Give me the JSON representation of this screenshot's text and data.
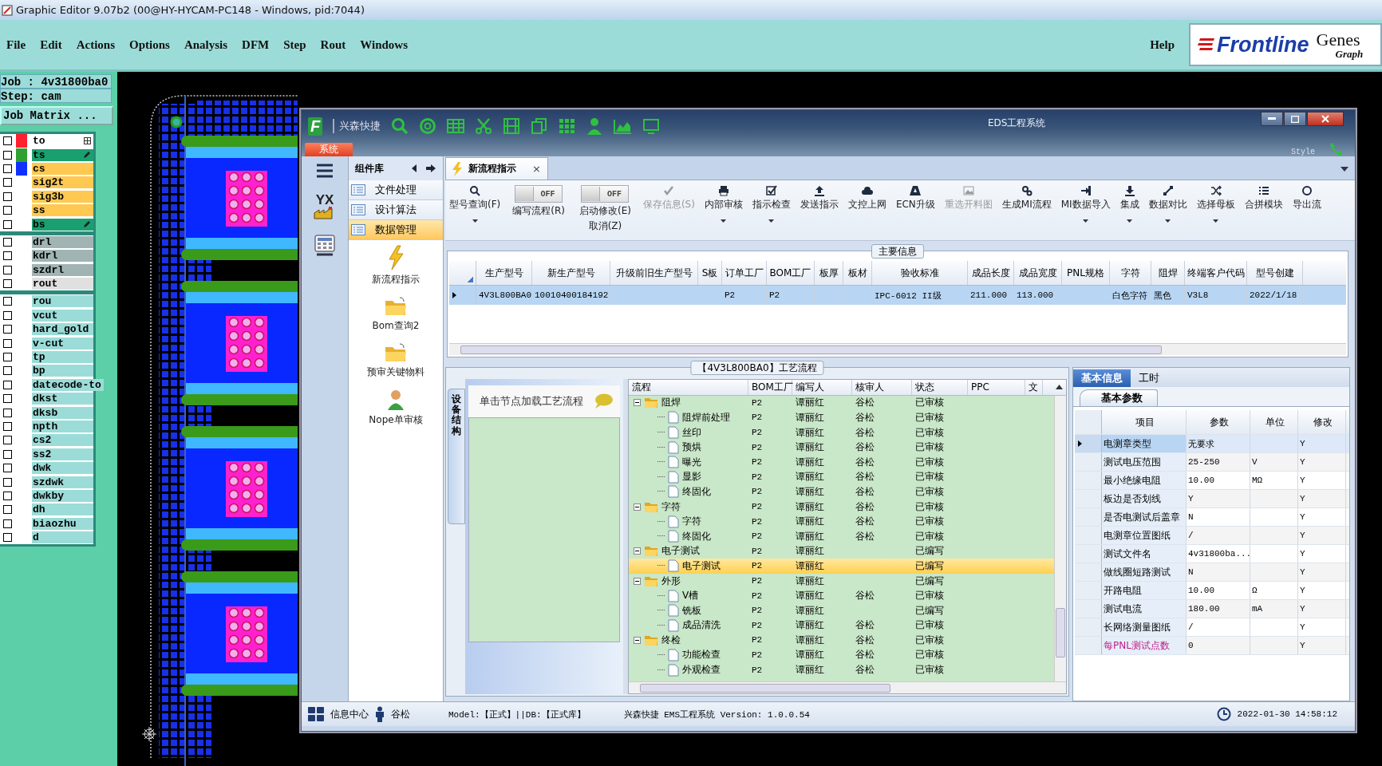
{
  "app_window": {
    "title": "Graphic Editor 9.07b2 (00@HY-HYCAM-PC148 - Windows, pid:7044)"
  },
  "menu": [
    "File",
    "Edit",
    "Actions",
    "Options",
    "Analysis",
    "DFM",
    "Step",
    "Rout",
    "Windows"
  ],
  "help": "Help",
  "logo": {
    "name": "Frontline",
    "product": "Genes",
    "subtitle": "Graph"
  },
  "job": {
    "job_label": "Job : 4v31800ba0",
    "step_label": "Step: cam",
    "matrix_button": "Job Matrix ..."
  },
  "layer_groups": [
    {
      "layers": [
        {
          "name": "to",
          "kind": "silk",
          "color": "#ff2030",
          "checked": false,
          "work_layer": true,
          "editable": false
        },
        {
          "name": "ts",
          "kind": "mask",
          "color": "#30a030",
          "checked": false,
          "work_layer": false,
          "editable": true
        },
        {
          "name": "cs",
          "kind": "signal",
          "color": "#1030ff",
          "checked": false,
          "work_layer": false,
          "editable": false
        },
        {
          "name": "sig2t",
          "kind": "signal",
          "checked": false,
          "work_layer": false,
          "editable": false
        },
        {
          "name": "sig3b",
          "kind": "signal",
          "checked": false,
          "work_layer": false,
          "editable": false
        },
        {
          "name": "ss",
          "kind": "signal",
          "checked": false,
          "work_layer": false,
          "editable": false
        },
        {
          "name": "bs",
          "kind": "mask",
          "checked": false,
          "work_layer": false,
          "editable": true
        }
      ]
    },
    {
      "layers": [
        {
          "name": "drl",
          "kind": "drill",
          "checked": false,
          "work_layer": false,
          "editable": false
        },
        {
          "name": "kdrl",
          "kind": "drill",
          "checked": false,
          "work_layer": false,
          "editable": false
        },
        {
          "name": "szdrl",
          "kind": "drill",
          "checked": false,
          "work_layer": false,
          "editable": false
        },
        {
          "name": "rout",
          "kind": "rout",
          "checked": false,
          "work_layer": false,
          "editable": false
        }
      ]
    },
    {
      "layers": [
        {
          "name": "rou",
          "kind": "misc",
          "checked": false,
          "work_layer": false,
          "editable": false
        },
        {
          "name": "vcut",
          "kind": "misc",
          "checked": false,
          "work_layer": false,
          "editable": false
        },
        {
          "name": "hard_gold",
          "kind": "misc",
          "checked": false,
          "work_layer": false,
          "editable": false
        },
        {
          "name": "v-cut",
          "kind": "misc",
          "checked": false,
          "work_layer": false,
          "editable": false
        },
        {
          "name": "tp",
          "kind": "misc",
          "checked": false,
          "work_layer": false,
          "editable": false
        },
        {
          "name": "bp",
          "kind": "misc",
          "checked": false,
          "work_layer": false,
          "editable": false
        },
        {
          "name": "datecode-to",
          "kind": "misc",
          "checked": false,
          "work_layer": false,
          "editable": false
        },
        {
          "name": "dkst",
          "kind": "misc",
          "checked": false,
          "work_layer": false,
          "editable": false
        },
        {
          "name": "dksb",
          "kind": "misc",
          "checked": false,
          "work_layer": false,
          "editable": false
        },
        {
          "name": "npth",
          "kind": "misc",
          "checked": false,
          "work_layer": false,
          "editable": false
        },
        {
          "name": "cs2",
          "kind": "misc",
          "checked": false,
          "work_layer": false,
          "editable": false
        },
        {
          "name": "ss2",
          "kind": "misc",
          "checked": false,
          "work_layer": false,
          "editable": false
        },
        {
          "name": "dwk",
          "kind": "misc",
          "checked": false,
          "work_layer": false,
          "editable": false
        },
        {
          "name": "szdwk",
          "kind": "misc",
          "checked": false,
          "work_layer": false,
          "editable": false
        },
        {
          "name": "dwkby",
          "kind": "misc",
          "checked": false,
          "work_layer": false,
          "editable": false
        },
        {
          "name": "dh",
          "kind": "misc",
          "checked": false,
          "work_layer": false,
          "editable": false
        },
        {
          "name": "biaozhu",
          "kind": "misc",
          "checked": false,
          "work_layer": false,
          "editable": false
        },
        {
          "name": "d",
          "kind": "misc",
          "checked": false,
          "work_layer": false,
          "editable": false
        }
      ]
    }
  ],
  "eds": {
    "app_letter": "F",
    "title": "EDS工程系统",
    "brand": "兴森快捷",
    "system_tab": "系统",
    "style_label": "Style",
    "nav_logo": "YX"
  },
  "component_panel": {
    "title": "组件库",
    "categories": [
      {
        "label": "文件处理",
        "selected": false
      },
      {
        "label": "设计算法",
        "selected": false
      },
      {
        "label": "数据管理",
        "selected": true
      }
    ],
    "tools": [
      "新流程指示",
      "Bom查询2",
      "预审关键物料",
      "Nope单审核"
    ]
  },
  "doc_tab": {
    "label": "新流程指示",
    "close": "×"
  },
  "ribbon": [
    {
      "kind": "button",
      "label": "型号查询(F)",
      "dropdown": true,
      "disabled": false
    },
    {
      "kind": "toggle",
      "label": "编写流程(R)",
      "state_text": "OFF",
      "on": false
    },
    {
      "kind": "toggle",
      "label": "启动修改(E)",
      "label2": "取消(Z)",
      "state_text": "OFF",
      "on": false
    },
    {
      "kind": "button",
      "label": "保存信息(S)",
      "dropdown": false,
      "disabled": true
    },
    {
      "kind": "button",
      "label": "内部审核",
      "dropdown": true,
      "disabled": false
    },
    {
      "kind": "button",
      "label": "指示检查",
      "dropdown": true,
      "disabled": false
    },
    {
      "kind": "button",
      "label": "发送指示",
      "dropdown": false,
      "disabled": false
    },
    {
      "kind": "button",
      "label": "文控上网",
      "dropdown": false,
      "disabled": false
    },
    {
      "kind": "button",
      "label": "ECN升级",
      "dropdown": false,
      "disabled": false
    },
    {
      "kind": "button",
      "label": "重选开料图",
      "dropdown": false,
      "disabled": true
    },
    {
      "kind": "button",
      "label": "生成MI流程",
      "dropdown": false,
      "disabled": false
    },
    {
      "kind": "button",
      "label": "MI数据导入",
      "dropdown": true,
      "disabled": false
    },
    {
      "kind": "button",
      "label": "集成",
      "dropdown": true,
      "disabled": false
    },
    {
      "kind": "button",
      "label": "数据对比",
      "dropdown": true,
      "disabled": false
    },
    {
      "kind": "button",
      "label": "选择母板",
      "dropdown": true,
      "disabled": false
    },
    {
      "kind": "button",
      "label": "合拼模块",
      "dropdown": false,
      "disabled": false
    },
    {
      "kind": "button",
      "label": "导出流",
      "dropdown": false,
      "disabled": false
    }
  ],
  "main_info": {
    "title": "主要信息",
    "columns": [
      "生产型号",
      "新生产型号",
      "升级前旧生产型号",
      "S板",
      "订单工厂",
      "BOM工厂",
      "板厚",
      "板材",
      "验收标准",
      "成品长度",
      "成品宽度",
      "PNL规格",
      "字符",
      "阻焊",
      "终端客户代码",
      "型号创建"
    ],
    "rows": [
      {
        "selected": true,
        "cells": [
          "4V3L800BA0",
          "10010400184192",
          "",
          "",
          "P2",
          "P2",
          "",
          "",
          "IPC-6012 II级",
          "211.000",
          "113.000",
          "",
          "白色字符",
          "黑色",
          "V3L8",
          "2022/1/18"
        ]
      }
    ]
  },
  "process": {
    "title": "【4V3L800BA0】工艺流程",
    "side_tab": "设备结构",
    "hint": "单击节点加载工艺流程",
    "columns": [
      "流程",
      "BOM工厂",
      "编写人",
      "核审人",
      "状态",
      "PPC",
      "文"
    ],
    "tree": [
      {
        "name": "阻焊",
        "factory": "P2",
        "writer": "谭丽红",
        "reviewer": "谷松",
        "status": "已审核",
        "expanded": true,
        "selected": false,
        "children": [
          {
            "name": "阻焊前处理",
            "factory": "P2",
            "writer": "谭丽红",
            "reviewer": "谷松",
            "status": "已审核",
            "selected": false
          },
          {
            "name": "丝印",
            "factory": "P2",
            "writer": "谭丽红",
            "reviewer": "谷松",
            "status": "已审核",
            "selected": false
          },
          {
            "name": "预烘",
            "factory": "P2",
            "writer": "谭丽红",
            "reviewer": "谷松",
            "status": "已审核",
            "selected": false
          },
          {
            "name": "曝光",
            "factory": "P2",
            "writer": "谭丽红",
            "reviewer": "谷松",
            "status": "已审核",
            "selected": false
          },
          {
            "name": "显影",
            "factory": "P2",
            "writer": "谭丽红",
            "reviewer": "谷松",
            "status": "已审核",
            "selected": false
          },
          {
            "name": "终固化",
            "factory": "P2",
            "writer": "谭丽红",
            "reviewer": "谷松",
            "status": "已审核",
            "selected": false
          }
        ]
      },
      {
        "name": "字符",
        "factory": "P2",
        "writer": "谭丽红",
        "reviewer": "谷松",
        "status": "已审核",
        "expanded": true,
        "selected": false,
        "children": [
          {
            "name": "字符",
            "factory": "P2",
            "writer": "谭丽红",
            "reviewer": "谷松",
            "status": "已审核",
            "selected": false
          },
          {
            "name": "终固化",
            "factory": "P2",
            "writer": "谭丽红",
            "reviewer": "谷松",
            "status": "已审核",
            "selected": false
          }
        ]
      },
      {
        "name": "电子测试",
        "factory": "P2",
        "writer": "谭丽红",
        "status": "已编写",
        "expanded": true,
        "selected": false,
        "children": [
          {
            "name": "电子测试",
            "factory": "P2",
            "writer": "谭丽红",
            "status": "已编写",
            "selected": true
          }
        ]
      },
      {
        "name": "外形",
        "factory": "P2",
        "writer": "谭丽红",
        "status": "已编写",
        "expanded": true,
        "selected": false,
        "children": [
          {
            "name": "V槽",
            "factory": "P2",
            "writer": "谭丽红",
            "reviewer": "谷松",
            "status": "已审核",
            "selected": false
          },
          {
            "name": "铣板",
            "factory": "P2",
            "writer": "谭丽红",
            "status": "已编写",
            "selected": false
          },
          {
            "name": "成品清洗",
            "factory": "P2",
            "writer": "谭丽红",
            "reviewer": "谷松",
            "status": "已审核",
            "selected": false
          }
        ]
      },
      {
        "name": "终检",
        "factory": "P2",
        "writer": "谭丽红",
        "reviewer": "谷松",
        "status": "已审核",
        "expanded": true,
        "selected": false,
        "children": [
          {
            "name": "功能检查",
            "factory": "P2",
            "writer": "谭丽红",
            "reviewer": "谷松",
            "status": "已审核",
            "selected": false
          },
          {
            "name": "外观检查",
            "factory": "P2",
            "writer": "谭丽红",
            "reviewer": "谷松",
            "status": "已审核",
            "selected": false
          }
        ]
      }
    ]
  },
  "params": {
    "tabs": [
      {
        "label": "基本信息",
        "selected": true
      },
      {
        "label": "工时",
        "selected": false
      }
    ],
    "subtab": "基本参数",
    "columns": [
      "项目",
      "参数",
      "单位",
      "修改"
    ],
    "rows": [
      {
        "item": "电测章类型",
        "value": "无要求",
        "unit": "",
        "modify": "Y",
        "selected": true,
        "highlight": false
      },
      {
        "item": "测试电压范围",
        "value": "25-250",
        "unit": "V",
        "modify": "Y",
        "selected": false,
        "highlight": false
      },
      {
        "item": "最小绝缘电阻",
        "value": "10.00",
        "unit": "MΩ",
        "modify": "Y",
        "selected": false,
        "highlight": false
      },
      {
        "item": "板边是否划线",
        "value": "Y",
        "unit": "",
        "modify": "Y",
        "selected": false,
        "highlight": false
      },
      {
        "item": "是否电测试后盖章",
        "value": "N",
        "unit": "",
        "modify": "Y",
        "selected": false,
        "highlight": false
      },
      {
        "item": "电测章位置图纸",
        "value": "/",
        "unit": "",
        "modify": "Y",
        "selected": false,
        "highlight": false
      },
      {
        "item": "测试文件名",
        "value": "4v31800ba...",
        "unit": "",
        "modify": "Y",
        "selected": false,
        "highlight": false
      },
      {
        "item": "做线圈短路测试",
        "value": "N",
        "unit": "",
        "modify": "Y",
        "selected": false,
        "highlight": false
      },
      {
        "item": "开路电阻",
        "value": "10.00",
        "unit": "Ω",
        "modify": "Y",
        "selected": false,
        "highlight": false
      },
      {
        "item": "测试电流",
        "value": "180.00",
        "unit": "mA",
        "modify": "Y",
        "selected": false,
        "highlight": false
      },
      {
        "item": "长网络测量图纸",
        "value": "/",
        "unit": "",
        "modify": "Y",
        "selected": false,
        "highlight": false
      },
      {
        "item": "每PNL测试点数",
        "value": "0",
        "unit": "",
        "modify": "Y",
        "selected": false,
        "highlight": true
      }
    ]
  },
  "status_bar": {
    "messages": "信息中心",
    "user": "谷松",
    "model": "Model:【正式】||DB:【正式库】",
    "version": "兴森快捷 EMS工程系统 Version: 1.0.0.54",
    "time": "2022-01-30 14:58:12"
  }
}
